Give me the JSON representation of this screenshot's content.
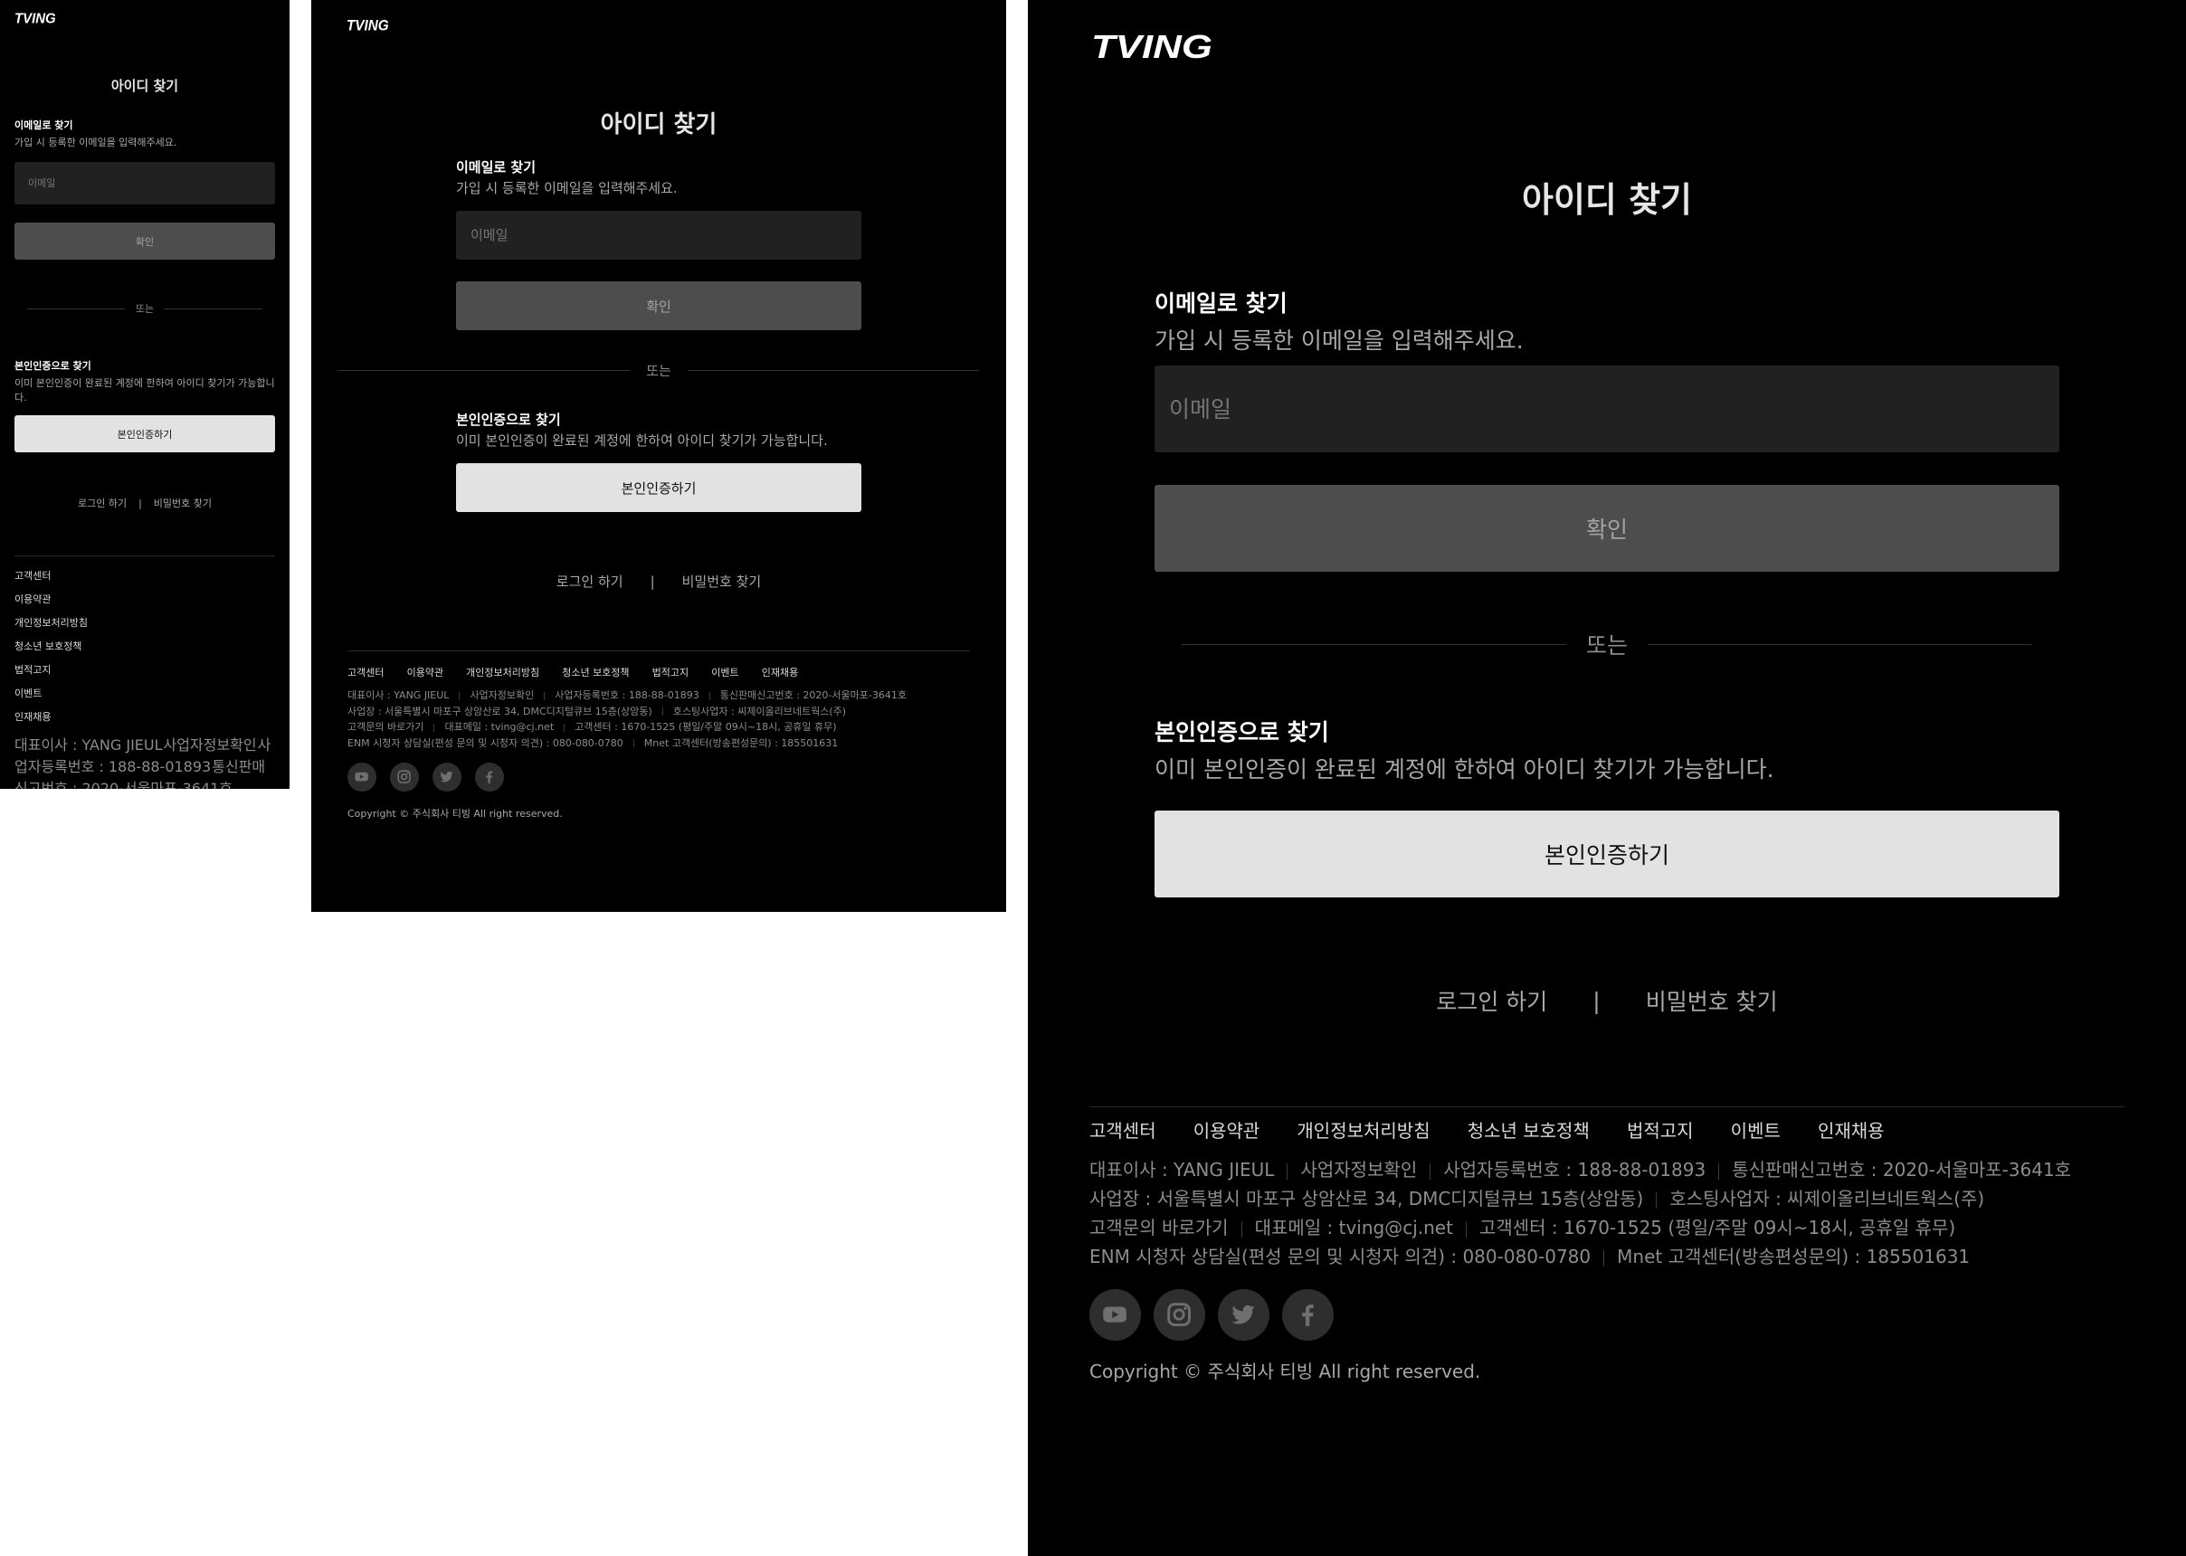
{
  "brand": {
    "logo_text": "TVING"
  },
  "page": {
    "title": "아이디 찾기",
    "email_section": {
      "title": "이메일로 찾기",
      "description": "가입 시 등록한 이메일을 입력해주세요.",
      "email_placeholder": "이메일",
      "confirm_label": "확인"
    },
    "divider_label": "또는",
    "verify_section": {
      "title": "본인인증으로 찾기",
      "description": "이미 본인인증이 완료된 계정에 한하여 아이디 찾기가 가능합니다.",
      "verify_label": "본인인증하기"
    },
    "links": {
      "login": "로그인 하기",
      "separator": "|",
      "find_password": "비밀번호 찾기"
    }
  },
  "footer": {
    "nav": [
      "고객센터",
      "이용약관",
      "개인정보처리방침",
      "청소년 보호정책",
      "법적고지",
      "이벤트",
      "인재채용"
    ],
    "info": {
      "ceo": "대표이사 : YANG JIEUL",
      "business_check": "사업자정보확인",
      "business_number": "사업자등록번호 : 188-88-01893",
      "ecommerce_number": "통신판매신고번호 : 2020-서울마포-3641호",
      "address": "사업장 : 서울특별시 마포구 상암산로 34, DMC디지털큐브 15층(상암동)",
      "hosting": "호스팅사업자 : 씨제이올리브네트웍스(주)",
      "inquiry": "고객문의 바로가기",
      "email": "대표메일 : tving@cj.net",
      "customer_center": "고객센터 : 1670-1525 (평일/주말 09시~18시, 공휴일 휴무)",
      "enm_viewer": "ENM 시청자 상담실(편성 문의 및 시청자 의견) : 080-080-0780",
      "mnet_center": "Mnet 고객센터(방송편성문의) : 185501631"
    },
    "social": [
      "youtube-icon",
      "instagram-icon",
      "twitter-icon",
      "facebook-icon"
    ],
    "copyright": "Copyright © 주식회사 티빙 All right reserved."
  },
  "theme": {
    "background": "#000000",
    "input_bg": "#212121",
    "confirm_bg": "#4d4d4d",
    "verify_bg": "#e2e2e2"
  }
}
